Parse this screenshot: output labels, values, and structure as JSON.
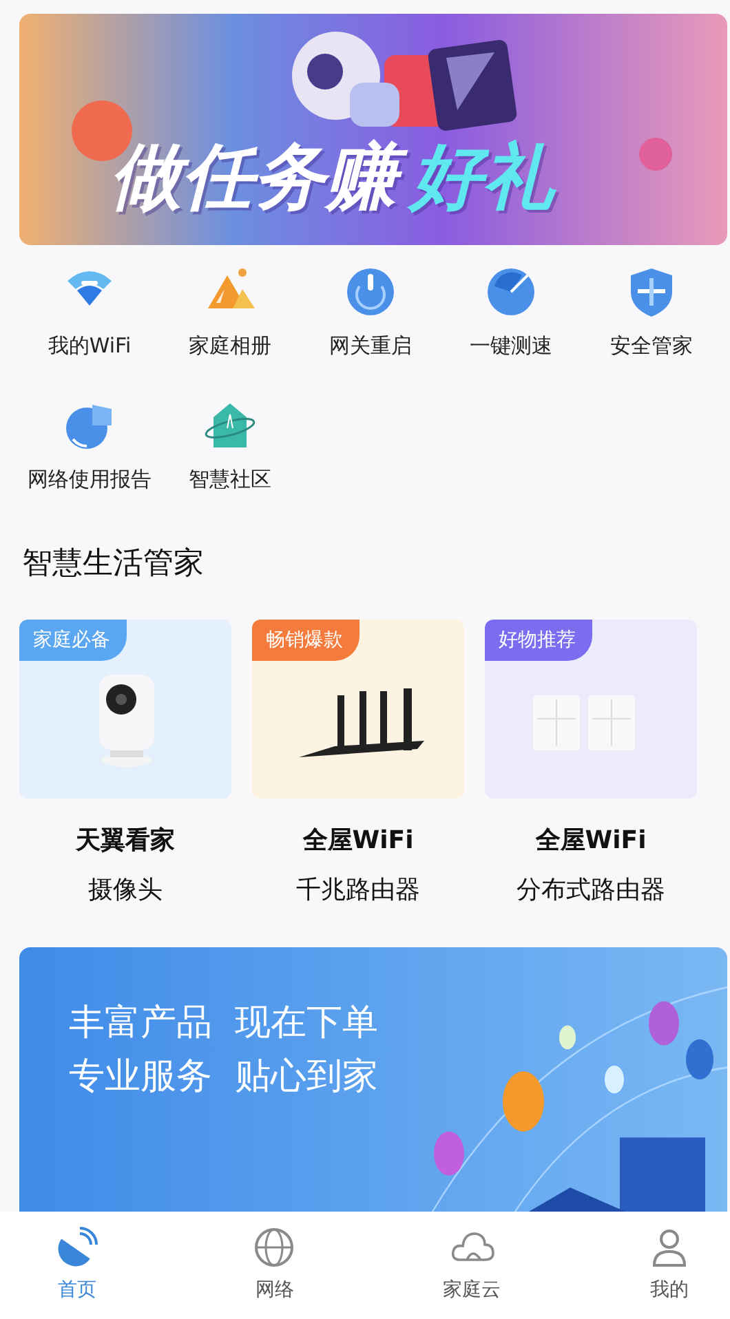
{
  "top_banner": {
    "title_lead": "做任务赚",
    "title_highlight": "好礼"
  },
  "features": [
    {
      "label": "我的WiFi"
    },
    {
      "label": "家庭相册"
    },
    {
      "label": "网关重启"
    },
    {
      "label": "一键测速"
    },
    {
      "label": "安全管家"
    },
    {
      "label": "网络使用报告"
    },
    {
      "label": "智慧社区"
    }
  ],
  "section_title": "智慧生活管家",
  "products": [
    {
      "tag": "家庭必备",
      "color": "#5aa6f0",
      "name": "天翼看家",
      "subtitle": "摄像头"
    },
    {
      "tag": "畅销爆款",
      "color": "#f47b3c",
      "name": "全屋WiFi",
      "subtitle": "千兆路由器"
    },
    {
      "tag": "好物推荐",
      "color": "#7b6cf0",
      "name": "全屋WiFi",
      "subtitle": "分布式路由器"
    }
  ],
  "promo_banner": {
    "lines": [
      "丰富产品  现在下单",
      "专业服务  贴心到家"
    ]
  },
  "tab_bar": [
    {
      "label": "首页",
      "selected": true
    },
    {
      "label": "网络",
      "selected": false
    },
    {
      "label": "家庭云",
      "selected": false
    },
    {
      "label": "我的",
      "selected": false
    }
  ]
}
